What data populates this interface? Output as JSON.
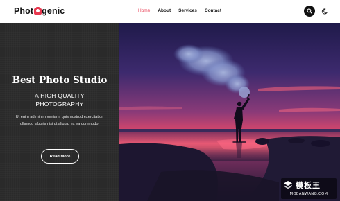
{
  "header": {
    "logo_prefix": "Phot",
    "logo_suffix": "genic",
    "nav": [
      {
        "label": "Home",
        "active": true
      },
      {
        "label": "About",
        "active": false
      },
      {
        "label": "Services",
        "active": false
      },
      {
        "label": "Contact",
        "active": false
      }
    ]
  },
  "hero": {
    "title": "Best Photo Studio",
    "subtitle_line1": "A HIGH QUALITY",
    "subtitle_line2": "PHOTOGRAPHY",
    "body": "Ut enim ad minim veniam, quis nostrud exercitation ullamco laboris nisi ut aliquip ex ea commodo.",
    "button_label": "Read More"
  },
  "watermark": {
    "text": "模板王",
    "url": "MOBANWANG.COM"
  },
  "colors": {
    "accent": "#e8384f",
    "dark_panel": "#2a2a2a",
    "header_bg": "#ffffff"
  },
  "icons": {
    "search": "search-icon",
    "theme": "moon-icon",
    "logo_camera": "camera-icon"
  }
}
